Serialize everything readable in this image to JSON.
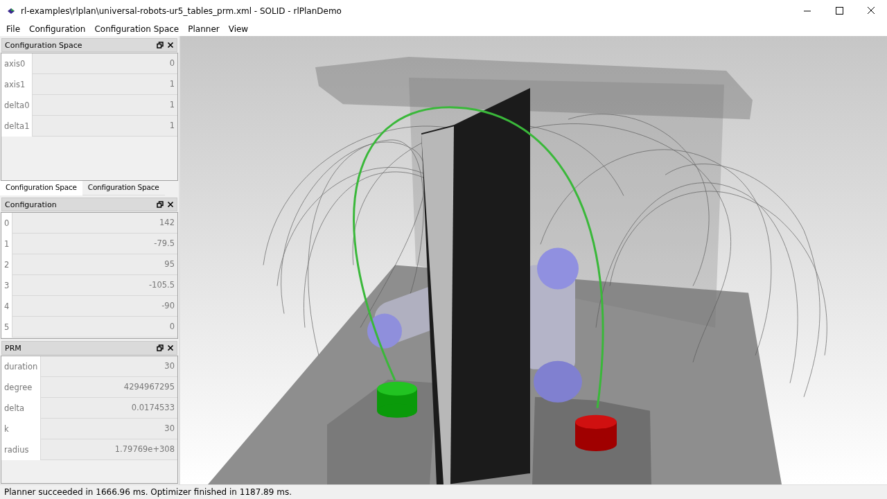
{
  "window": {
    "title": "rl-examples\\rlplan\\universal-robots-ur5_tables_prm.xml - SOLID - rlPlanDemo"
  },
  "menu": [
    "File",
    "Configuration",
    "Configuration Space",
    "Planner",
    "View"
  ],
  "docks": [
    {
      "title": "Configuration Space",
      "rows": [
        {
          "label": "axis0",
          "value": "0"
        },
        {
          "label": "axis1",
          "value": "1"
        },
        {
          "label": "delta0",
          "value": "1"
        },
        {
          "label": "delta1",
          "value": "1"
        }
      ]
    },
    {
      "title": "Configuration",
      "rows": [
        {
          "label": "0",
          "value": "142"
        },
        {
          "label": "1",
          "value": "-79.5"
        },
        {
          "label": "2",
          "value": "95"
        },
        {
          "label": "3",
          "value": "-105.5"
        },
        {
          "label": "4",
          "value": "-90"
        },
        {
          "label": "5",
          "value": "0"
        }
      ]
    },
    {
      "title": "PRM",
      "rows": [
        {
          "label": "duration",
          "value": "30"
        },
        {
          "label": "degree",
          "value": "4294967295"
        },
        {
          "label": "delta",
          "value": "0.0174533"
        },
        {
          "label": "k",
          "value": "30"
        },
        {
          "label": "radius",
          "value": "1.79769e+308"
        }
      ]
    }
  ],
  "dock_tabs": [
    {
      "label": "Configuration Space",
      "selected": true
    },
    {
      "label": "Configuration Space",
      "selected": false
    }
  ],
  "status_bar": "Planner succeeded in 1666.96 ms. Optimizer finished in 1187.89 ms."
}
